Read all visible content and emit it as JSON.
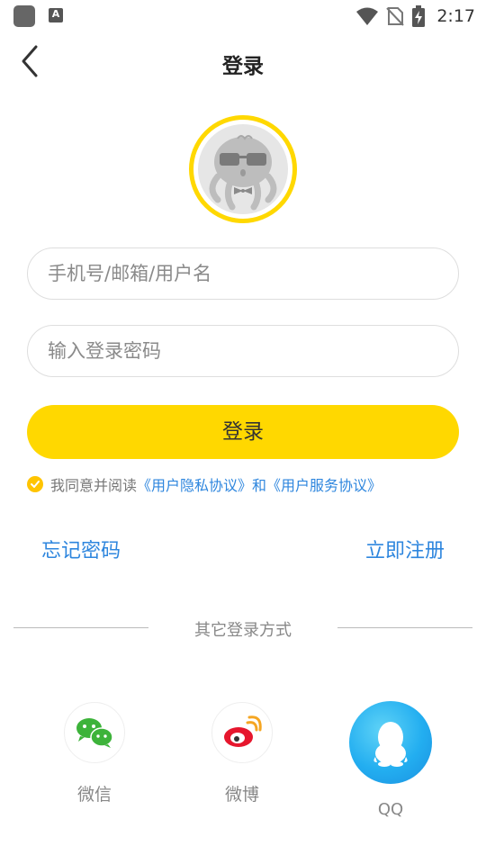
{
  "status_bar": {
    "time": "2:17",
    "a_icon_letter": "A"
  },
  "header": {
    "title": "登录"
  },
  "form": {
    "username_placeholder": "手机号/邮箱/用户名",
    "password_placeholder": "输入登录密码",
    "login_label": "登录"
  },
  "agreement": {
    "prefix": "我同意并阅读",
    "privacy_link": "《用户隐私协议》",
    "and": "和",
    "service_link": "《用户服务协议》",
    "checked": true
  },
  "links": {
    "forgot": "忘记密码",
    "register": "立即注册"
  },
  "other_login": {
    "title": "其它登录方式",
    "options": [
      {
        "label": "微信",
        "icon": "wechat-icon"
      },
      {
        "label": "微博",
        "icon": "weibo-icon"
      },
      {
        "label": "QQ",
        "icon": "qq-icon"
      }
    ]
  },
  "colors": {
    "accent": "#FFD800",
    "link": "#2E86DE"
  }
}
